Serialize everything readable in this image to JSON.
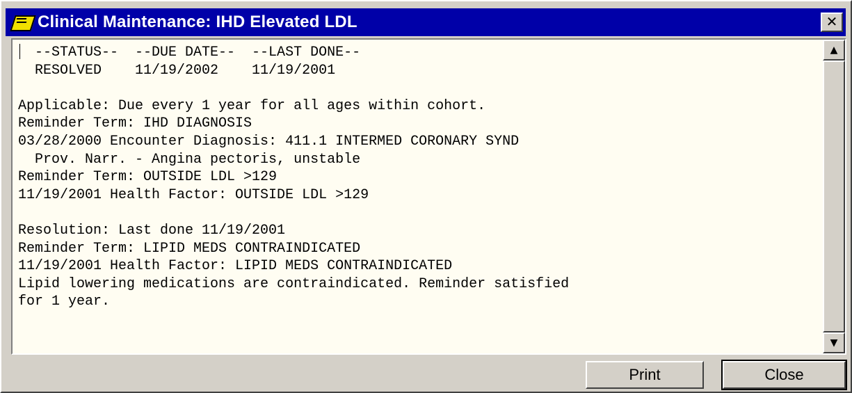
{
  "window": {
    "title": "Clinical Maintenance: IHD Elevated LDL",
    "close_glyph": "✕"
  },
  "report": {
    "lines": [
      "  --STATUS--  --DUE DATE--  --LAST DONE--",
      "  RESOLVED    11/19/2002    11/19/2001",
      "",
      "Applicable: Due every 1 year for all ages within cohort.",
      "Reminder Term: IHD DIAGNOSIS",
      "03/28/2000 Encounter Diagnosis: 411.1 INTERMED CORONARY SYND",
      "  Prov. Narr. - Angina pectoris, unstable",
      "Reminder Term: OUTSIDE LDL >129",
      "11/19/2001 Health Factor: OUTSIDE LDL >129",
      "",
      "Resolution: Last done 11/19/2001",
      "Reminder Term: LIPID MEDS CONTRAINDICATED",
      "11/19/2001 Health Factor: LIPID MEDS CONTRAINDICATED",
      "Lipid lowering medications are contraindicated. Reminder satisfied",
      "for 1 year."
    ]
  },
  "scrollbar": {
    "up_glyph": "▲",
    "down_glyph": "▼"
  },
  "buttons": {
    "print_label": "Print",
    "close_label": "Close"
  },
  "icons": {
    "app": "reminder-book-icon",
    "close": "close-icon",
    "scroll_up": "scroll-up-arrow-icon",
    "scroll_down": "scroll-down-arrow-icon"
  },
  "colors": {
    "titlebar": "#0000a8",
    "pane_background": "#fffdf2",
    "chrome": "#d4d0c8"
  }
}
